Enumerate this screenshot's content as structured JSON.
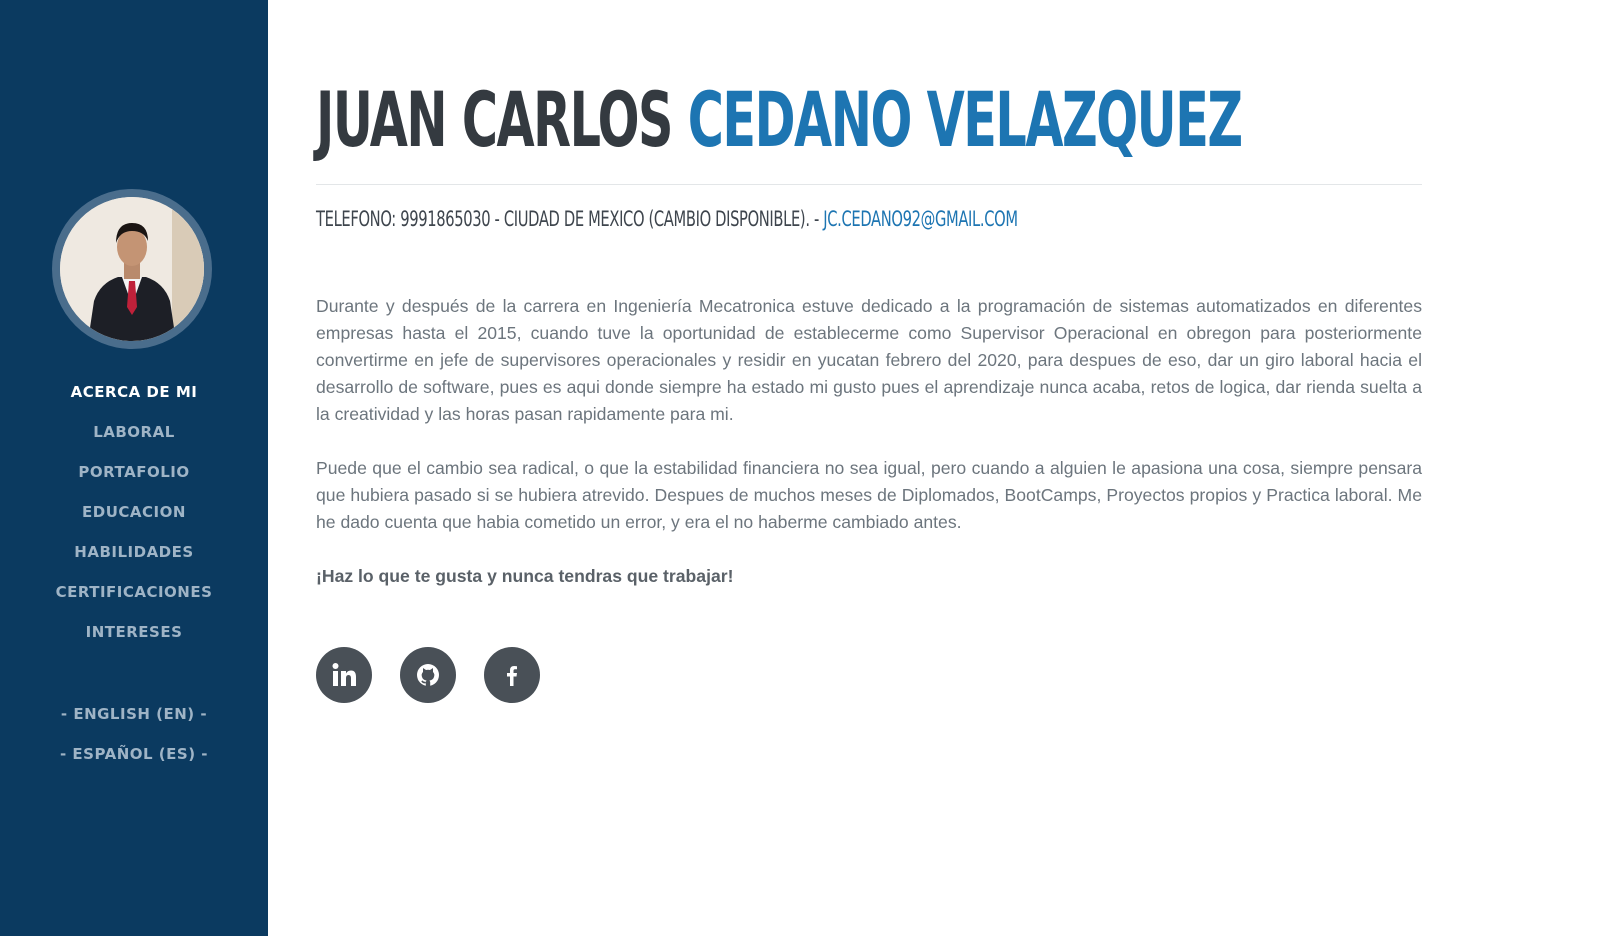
{
  "profile": {
    "first_name": "JUAN CARLOS",
    "last_name": "CEDANO VELAZQUEZ",
    "contact_text": "TELEFONO: 9991865030 - CIUDAD DE MEXICO (CAMBIO DISPONIBLE). -",
    "email": "JC.CEDANO92@GMAIL.COM"
  },
  "sidebar": {
    "items": [
      {
        "label": "ACERCA DE MI",
        "active": true
      },
      {
        "label": "LABORAL"
      },
      {
        "label": "PORTAFOLIO"
      },
      {
        "label": "EDUCACION"
      },
      {
        "label": "HABILIDADES"
      },
      {
        "label": "CERTIFICACIONES"
      },
      {
        "label": "INTERESES"
      }
    ],
    "languages": [
      {
        "label": "- ENGLISH (EN) -"
      },
      {
        "label": "- ESPAÑOL (ES) -"
      }
    ]
  },
  "about": {
    "paragraph1": "Durante y después de la carrera en Ingeniería Mecatronica estuve dedicado a la programación de sistemas automatizados en diferentes empresas hasta el 2015, cuando tuve la oportunidad de establecerme como Supervisor Operacional en obregon para posteriormente convertirme en jefe de supervisores operacionales y residir en yucatan febrero del 2020, para despues de eso, dar un giro laboral hacia el desarrollo de software, pues es aqui donde siempre ha estado mi gusto pues el aprendizaje nunca acaba, retos de logica, dar rienda suelta a la creatividad y las horas pasan rapidamente para mi.",
    "paragraph2": "Puede que el cambio sea radical, o que la estabilidad financiera no sea igual, pero cuando a alguien le apasiona una cosa, siempre pensara que hubiera pasado si se hubiera atrevido. Despues de muchos meses de Diplomados, BootCamps, Proyectos propios y Practica laboral. Me he dado cuenta que habia cometido un error, y era el no haberme cambiado antes.",
    "quote": "¡Haz lo que te gusta y nunca tendras que trabajar!"
  },
  "social": [
    {
      "icon": "linkedin-icon"
    },
    {
      "icon": "github-icon"
    },
    {
      "icon": "facebook-icon"
    }
  ],
  "colors": {
    "sidebar_bg": "#0b3a60",
    "accent": "#1d75b2",
    "heading": "#343a40",
    "body_text": "#6c757d",
    "social_bg": "#495057"
  }
}
